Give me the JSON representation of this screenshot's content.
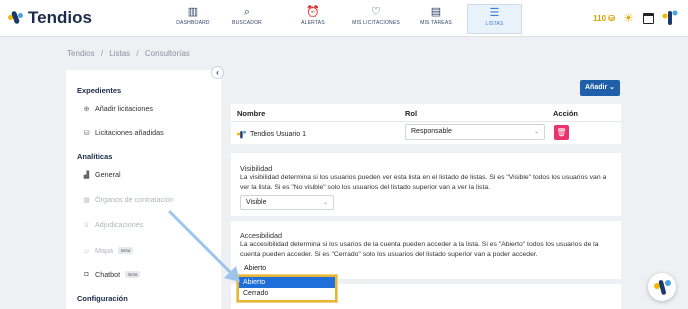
{
  "app": {
    "name": "Tendios"
  },
  "nav": [
    {
      "label": "DASHBOARD",
      "icon": "bar-chart-icon"
    },
    {
      "label": "BUSCADOR",
      "icon": "search-icon"
    },
    {
      "label": "ALERTAS",
      "icon": "alarm-clock-icon"
    },
    {
      "label": "MIS LICITACIONES",
      "icon": "heart-icon"
    },
    {
      "label": "MIS TAREAS",
      "icon": "task-board-icon"
    },
    {
      "label": "LISTAS",
      "icon": "list-icon",
      "active": true
    }
  ],
  "topright": {
    "credits": "110"
  },
  "breadcrumb": [
    "Tendios",
    "/",
    "Listas",
    "/",
    "Consultorías"
  ],
  "sidebar": {
    "sections": [
      {
        "title": "Expedientes"
      },
      {
        "title": "Analíticas"
      },
      {
        "title": "Configuración"
      }
    ],
    "items": [
      {
        "label": "Añadir licitaciones",
        "icon": "plus-circle-icon",
        "disabled": false
      },
      {
        "label": "Licitaciones añadidas",
        "icon": "stack-icon",
        "disabled": false
      },
      {
        "label": "General",
        "icon": "chart-icon",
        "disabled": false
      },
      {
        "label": "Órganos de contratación",
        "icon": "building-icon",
        "disabled": true
      },
      {
        "label": "Adjudicaciones",
        "icon": "trophy-icon",
        "disabled": true
      },
      {
        "label": "Mapa",
        "icon": "map-icon",
        "disabled": true,
        "badge": "Beta"
      },
      {
        "label": "Chatbot",
        "icon": "robot-icon",
        "disabled": false,
        "badge": "Beta"
      }
    ]
  },
  "actions": {
    "add_label": "Añadir"
  },
  "table": {
    "headers": {
      "name": "Nombre",
      "role": "Rol",
      "action": "Acción"
    },
    "row": {
      "name": "Tendios Usuario 1",
      "role": "Responsable"
    }
  },
  "visibility": {
    "title": "Visibilidad",
    "desc": "La visibilidad determina si los usuarios pueden ver esta lista en el listado de listas. Si es \"Visible\" todos los usuarios van a ver la lista. Si es \"No visible\" solo los usuarios del listado superior van a ver la lista.",
    "value": "Visible"
  },
  "accessibility": {
    "title": "Accesibilidad",
    "desc": "La accesibilidad determina si los usarios de la cuenta pueden acceder a la lista. Si es \"Abierto\" todos los usuarios de la cuenta pueden acceder. Si es \"Cerrado\" solo los usuarios del listado superior van a poder acceder.",
    "value": "Abierto",
    "options": [
      "Abierto",
      "Cerrado"
    ]
  },
  "colors": {
    "primary": "#1f5ea8",
    "danger": "#e8336d",
    "highlight": "#e8b43a",
    "selected": "#1e6fd9"
  }
}
